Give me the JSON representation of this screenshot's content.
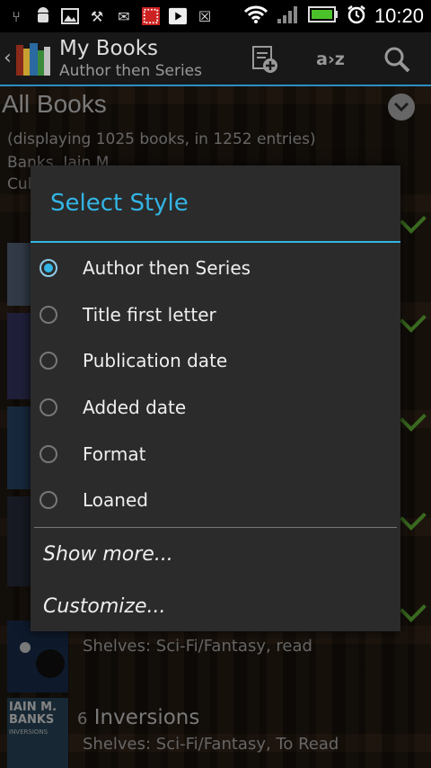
{
  "status_bar": {
    "time": "10:20",
    "icons": [
      "usb-icon",
      "android-icon",
      "image-icon",
      "tools-icon",
      "mail-icon",
      "pattern-app-icon",
      "play-icon",
      "no-sync-icon",
      "wifi-icon",
      "signal-icon",
      "battery-icon",
      "alarm-icon"
    ]
  },
  "action_bar": {
    "title": "My Books",
    "subtitle": "Author then Series",
    "sort_label": "a›z",
    "accent_color": "#33b5e5"
  },
  "list": {
    "header": "All Books",
    "count_text": "(displaying 1025 books, in 1252 entries)",
    "author": "Banks, Iain M",
    "series_partial": "Cul",
    "shelves_1": "Shelves: Sci-Fi/Fantasy, read",
    "book_number": "6",
    "book_title": "Inversions",
    "shelves_2": "Shelves: Sci-Fi/Fantasy, To Read",
    "thumb_author": "IAIN M. BANKS",
    "thumb_title": "INVERSIONS"
  },
  "dialog": {
    "title": "Select Style",
    "options": [
      {
        "label": "Author then Series",
        "selected": true
      },
      {
        "label": "Title first letter",
        "selected": false
      },
      {
        "label": "Publication date",
        "selected": false
      },
      {
        "label": "Added date",
        "selected": false
      },
      {
        "label": "Format",
        "selected": false
      },
      {
        "label": "Loaned",
        "selected": false
      }
    ],
    "show_more": "Show more...",
    "customize": "Customize..."
  }
}
